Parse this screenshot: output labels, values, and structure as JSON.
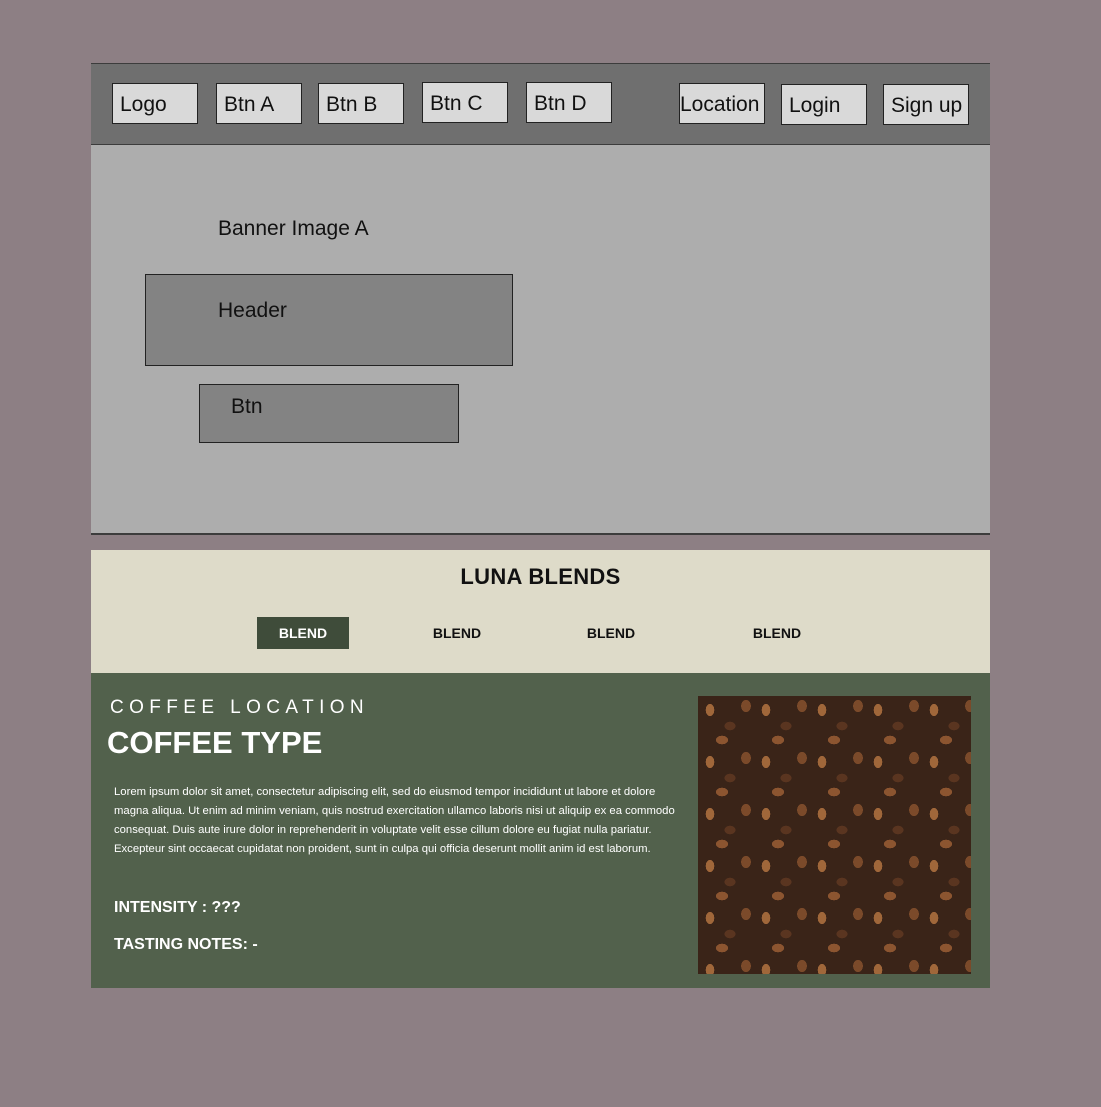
{
  "navbar": {
    "logo": "Logo",
    "buttons": [
      "Btn A",
      "Btn B",
      "Btn C",
      "Btn D"
    ],
    "location": "Location",
    "login": "Login",
    "signup": "Sign up"
  },
  "banner": {
    "image_label": "Banner Image A",
    "header": "Header",
    "button": "Btn"
  },
  "blends": {
    "title": "LUNA BLENDS",
    "tabs": [
      "BLEND",
      "BLEND",
      "BLEND",
      "BLEND"
    ],
    "active_index": 0
  },
  "detail": {
    "location": "COFFEE LOCATION",
    "type": "COFFEE TYPE",
    "description": "Lorem ipsum dolor sit amet, consectetur adipiscing elit, sed do eiusmod tempor incididunt ut labore et dolore magna aliqua. Ut enim ad minim veniam, quis nostrud exercitation ullamco laboris nisi ut aliquip ex ea commodo consequat. Duis aute irure dolor in reprehenderit in voluptate velit esse cillum dolore eu fugiat nulla pariatur. Excepteur sint occaecat cupidatat non proident, sunt in culpa qui officia deserunt mollit anim id est laborum.",
    "intensity": "INTENSITY : ???",
    "tasting_notes": "TASTING NOTES: -"
  },
  "colors": {
    "page_bg": "#8d7f84",
    "nav_bg": "#6f6f6f",
    "banner_bg": "#adadad",
    "blends_bg": "#dedbc9",
    "detail_bg": "#52614c",
    "active_tab": "#3f4c3a"
  }
}
